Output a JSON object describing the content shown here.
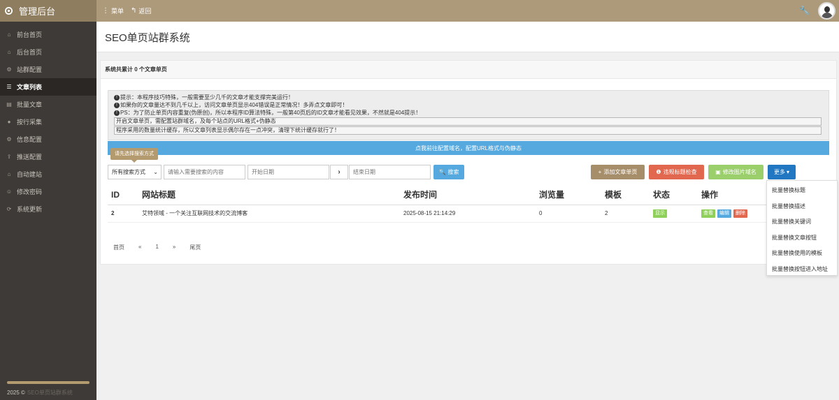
{
  "brand": {
    "title": "管理后台"
  },
  "topnav": {
    "menu": "菜单",
    "back": "返回"
  },
  "sidebar": {
    "items": [
      {
        "label": "前台首页",
        "icon": "home-icon"
      },
      {
        "label": "后台首页",
        "icon": "home-icon"
      },
      {
        "label": "站群配置",
        "icon": "gear-icon"
      },
      {
        "label": "文章列表",
        "icon": "list-icon",
        "active": true
      },
      {
        "label": "批量文章",
        "icon": "doc-icon"
      },
      {
        "label": "按行采集",
        "icon": "dot-icon"
      },
      {
        "label": "信息配置",
        "icon": "gear-icon"
      },
      {
        "label": "推送配置",
        "icon": "push-icon"
      },
      {
        "label": "自动建站",
        "icon": "bank-icon"
      },
      {
        "label": "修改密码",
        "icon": "user-icon"
      },
      {
        "label": "系统更新",
        "icon": "update-icon"
      }
    ],
    "footer_year": "2025 ©",
    "footer_faint": "SEO单页站群系统"
  },
  "page": {
    "title": "SEO单页站群系统"
  },
  "panel": {
    "header": "系统共累计 0 个文章单页"
  },
  "notice": {
    "line1": "提示：本程序技巧特殊，一般需要至少几千的文章才能支撑完美运行！",
    "line2": "如果你的文章量达不到几千以上，访问文章单页显示404错误是正常情况！多弄点文章即可！",
    "line3": "PS：为了防止单页内容重复(伪原创)，所以本程序ID算法特殊，一般第40页后的ID文章才能看见效果，不然就是404提示！",
    "box1": "开启文章单页，需配置站群域名，及每个站点的URL格式+伪静态",
    "box2": "程序采用的数量统计缓存，所以文章列表显示偶尔存在一点冲突，清理下统计缓存就行了！"
  },
  "blue_bar": "点我前往配置域名，配置URL格式与伪静态",
  "tooltip": "请先选择搜索方式",
  "search": {
    "mode": "所有搜索方式",
    "keyword_placeholder": "请输入需要搜索的内容",
    "start_placeholder": "开始日期",
    "end_placeholder": "结束日期",
    "search_btn": "搜索"
  },
  "actions": {
    "add": "添加文章单页",
    "check": "违规标题检查",
    "img": "修改图片域名",
    "more": "更多"
  },
  "more_menu": [
    "批量替换标题",
    "批量替换描述",
    "批量替换关键词",
    "批量替换文章按钮",
    "批量替换使用的模板",
    "批量替换按钮进入地址"
  ],
  "table": {
    "headers": [
      "ID",
      "网站标题",
      "发布时间",
      "浏览量",
      "模板",
      "状态",
      "操作"
    ],
    "rows": [
      {
        "id": "2",
        "title": "艾特领域 - 一个关注互联网技术的交流博客",
        "time": "2025-08-15 21:14:29",
        "views": "0",
        "template": "2",
        "status": "显示",
        "view": "查看",
        "edit": "编辑",
        "delete": "删除"
      }
    ]
  },
  "pager": [
    "首页",
    "«",
    "1",
    "»",
    "尾页"
  ],
  "colors": {
    "topbar": "#ad9a7b",
    "sidebar": "#3e3a37",
    "accent_blue": "#56a9de",
    "add": "#a78e6b",
    "danger": "#e1674f",
    "success": "#9bcf6b",
    "more": "#2277c2"
  }
}
